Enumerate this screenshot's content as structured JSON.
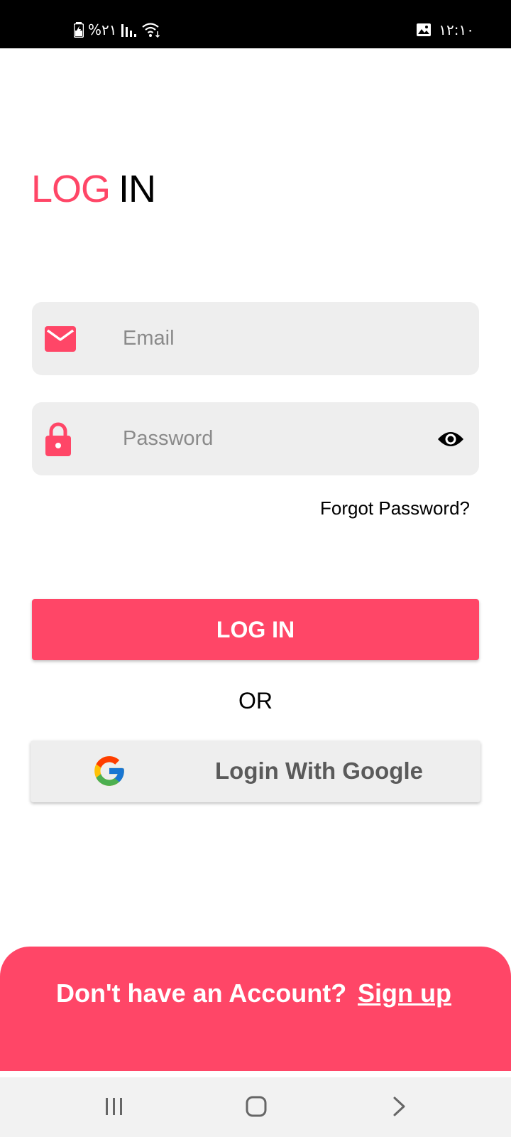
{
  "status_bar": {
    "battery_percent": "%۲۱",
    "time": "۱۲:۱۰"
  },
  "title": {
    "accent": "LOG",
    "plain": "IN"
  },
  "form": {
    "email_placeholder": "Email",
    "password_placeholder": "Password",
    "forgot_label": "Forgot Password?",
    "login_label": "LOG IN",
    "or_label": "OR",
    "google_label": "Login With Google"
  },
  "footer": {
    "prompt": "Don't have an Account?",
    "signup_label": "Sign up"
  },
  "colors": {
    "accent": "#ff4667",
    "field_bg": "#eeeeee"
  },
  "icons": {
    "email": "envelope-icon",
    "password": "lock-icon",
    "toggle": "eye-icon",
    "google": "google-logo-icon"
  }
}
